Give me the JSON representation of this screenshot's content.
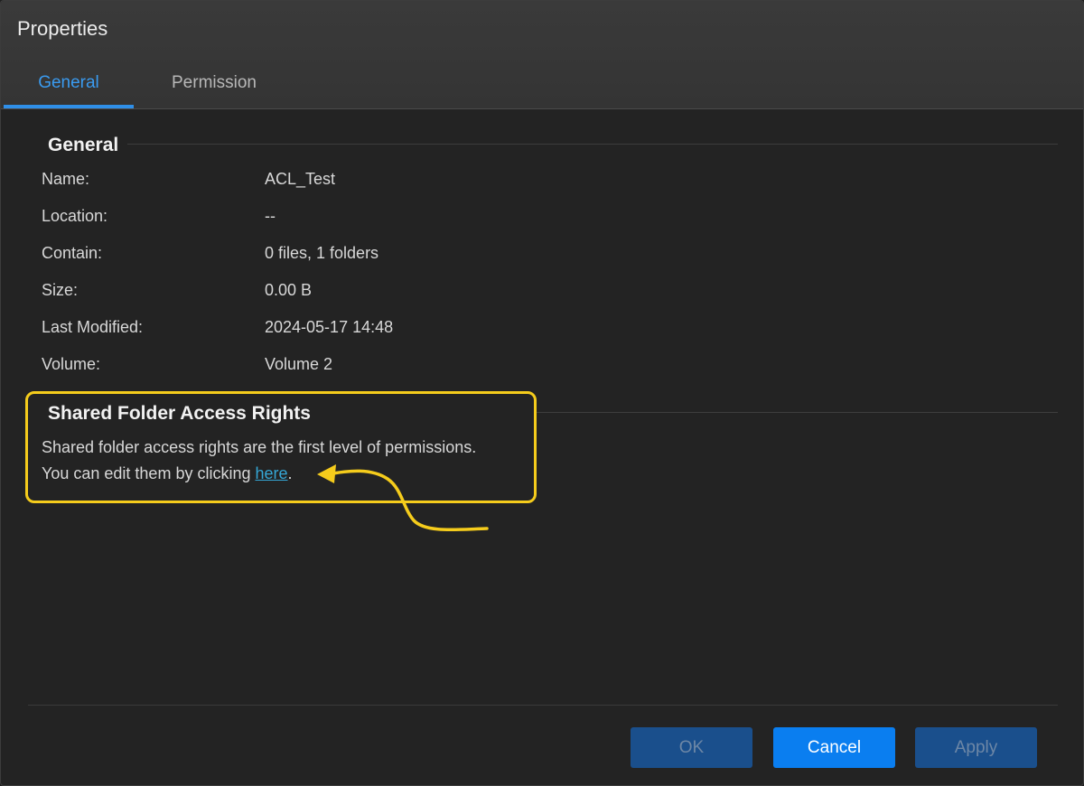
{
  "window": {
    "title": "Properties"
  },
  "tabs": [
    {
      "label": "General",
      "active": true
    },
    {
      "label": "Permission",
      "active": false
    }
  ],
  "general_section": {
    "title": "General",
    "rows": [
      {
        "label": "Name:",
        "value": "ACL_Test"
      },
      {
        "label": "Location:",
        "value": "--"
      },
      {
        "label": "Contain:",
        "value": "0 files, 1 folders"
      },
      {
        "label": "Size:",
        "value": "0.00 B"
      },
      {
        "label": "Last Modified:",
        "value": "2024-05-17 14:48"
      },
      {
        "label": "Volume:",
        "value": "Volume 2"
      }
    ]
  },
  "access_section": {
    "title": "Shared Folder Access Rights",
    "line1": "Shared folder access rights are the first level of permissions.",
    "line2_prefix": "You can edit them by clicking ",
    "link_text": "here",
    "line2_suffix": "."
  },
  "buttons": {
    "ok": "OK",
    "cancel": "Cancel",
    "apply": "Apply"
  },
  "colors": {
    "accent": "#2f8fe8",
    "highlight": "#f5cc1c",
    "link": "#35a7d6",
    "primary_button": "#0a7ef0",
    "disabled_button": "#1a4f8c"
  }
}
